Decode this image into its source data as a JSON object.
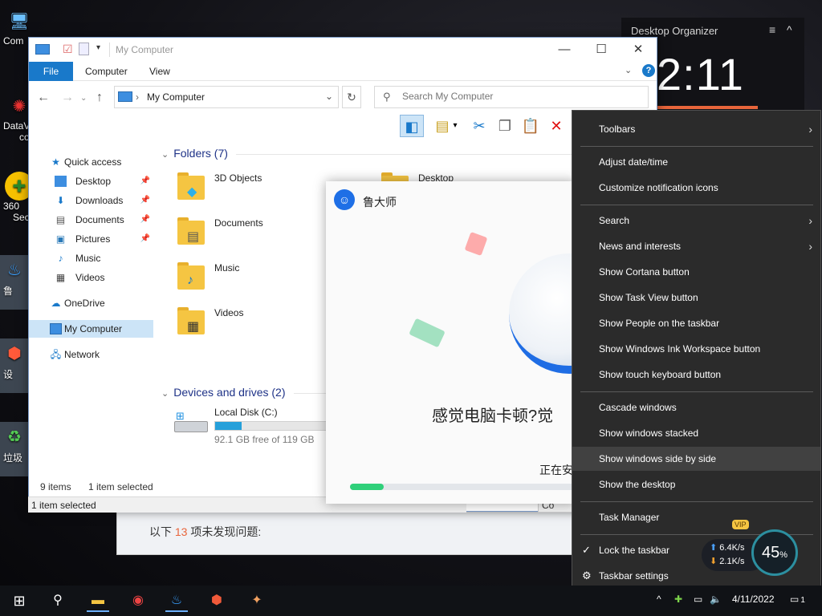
{
  "desktop": {
    "icons": [
      {
        "label": "Com",
        "icon": "computer-icon"
      },
      {
        "label": "DataV",
        "sub": "co",
        "icon": "datav-icon"
      },
      {
        "label": "360",
        "sub": "Sec",
        "icon": "360-security-icon"
      },
      {
        "label": "鲁",
        "icon": "app-shortcut-icon"
      },
      {
        "label": "设",
        "icon": "app-shortcut-icon"
      },
      {
        "label": "垃圾",
        "icon": "recycle-bin-icon"
      }
    ]
  },
  "widget": {
    "title": "Desktop Organizer",
    "time": "2:11",
    "menu_icon": "≡",
    "collapse_icon": "^"
  },
  "back_window": {
    "text_before": "以下 ",
    "count": "13",
    "text_after": " 项未发现问题:"
  },
  "explorer": {
    "title": "My Computer",
    "tabs": {
      "file": "File",
      "computer": "Computer",
      "view": "View"
    },
    "address": "My Computer",
    "search_placeholder": "Search My Computer",
    "nav": {
      "quick_access": "Quick access",
      "items": [
        {
          "label": "Desktop",
          "pinned": true
        },
        {
          "label": "Downloads",
          "pinned": true
        },
        {
          "label": "Documents",
          "pinned": true
        },
        {
          "label": "Pictures",
          "pinned": true
        },
        {
          "label": "Music",
          "pinned": false
        },
        {
          "label": "Videos",
          "pinned": false
        }
      ],
      "onedrive": "OneDrive",
      "mycomputer": "My Computer",
      "network": "Network"
    },
    "folders_header": "Folders (7)",
    "folders_left": [
      "3D Objects",
      "Documents",
      "Music",
      "Videos"
    ],
    "folders_right": [
      "Desktop"
    ],
    "drives_header": "Devices and drives (2)",
    "drive": {
      "name": "Local Disk (C:)",
      "free": "92.1 GB free of 119 GB",
      "used_fraction": 0.226
    },
    "status": {
      "items": "9 items",
      "selected": "1 item selected"
    },
    "status_bottom": "1 item selected",
    "status_bottom_right": "Co"
  },
  "popup": {
    "app_name": "鲁大师",
    "message": "感觉电脑卡顿?觉",
    "progress_text": "正在安",
    "progress_fraction": 0.14
  },
  "context_menu": {
    "groups": [
      [
        {
          "label": "Toolbars",
          "submenu": true
        }
      ],
      [
        {
          "label": "Adjust date/time"
        },
        {
          "label": "Customize notification icons"
        }
      ],
      [
        {
          "label": "Search",
          "submenu": true
        },
        {
          "label": "News and interests",
          "submenu": true
        },
        {
          "label": "Show Cortana button"
        },
        {
          "label": "Show Task View button"
        },
        {
          "label": "Show People on the taskbar"
        },
        {
          "label": "Show Windows Ink Workspace button"
        },
        {
          "label": "Show touch keyboard button"
        }
      ],
      [
        {
          "label": "Cascade windows"
        },
        {
          "label": "Show windows stacked"
        },
        {
          "label": "Show windows side by side",
          "highlighted": true
        },
        {
          "label": "Show the desktop"
        }
      ],
      [
        {
          "label": "Task Manager"
        }
      ],
      [
        {
          "label": "Lock the taskbar",
          "checked": true
        },
        {
          "label": "Taskbar settings",
          "gear": true
        }
      ]
    ]
  },
  "net_widget": {
    "up": "6.4",
    "down": "2.1",
    "unit": "K/s",
    "percent": "45",
    "percent_sign": "%",
    "vip": "VIP"
  },
  "taskbar": {
    "date": "4/11/2022",
    "notification_count": "1"
  },
  "colors": {
    "accent": "#1979ca",
    "menu_bg": "#2b2b2b",
    "highlight": "#414141",
    "orange": "#e8653b",
    "progress_green": "#2fd07a"
  }
}
